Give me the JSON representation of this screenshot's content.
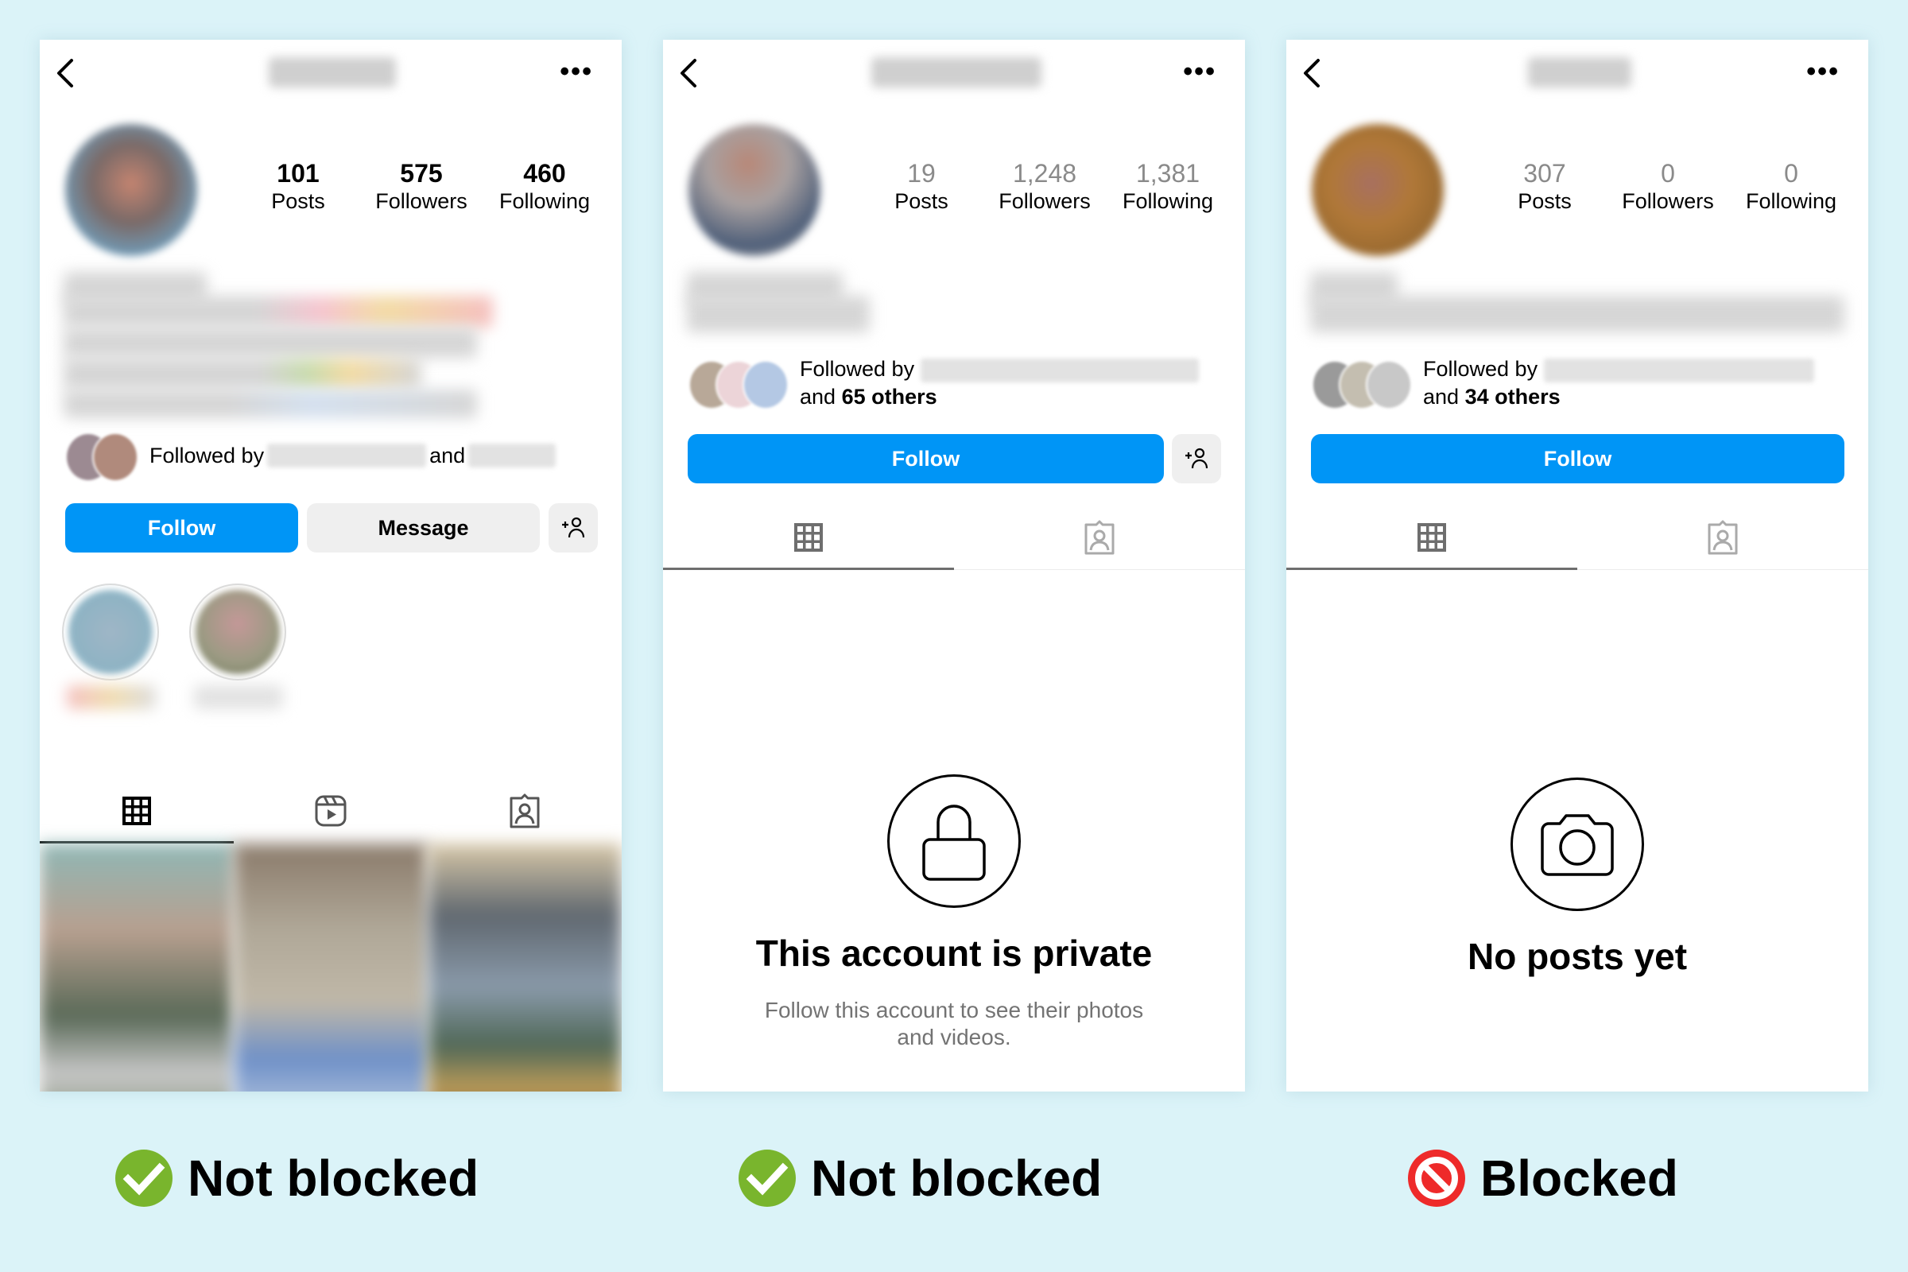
{
  "colors": {
    "background": "#dbf3f8",
    "follow_button": "#0095f6",
    "secondary_button": "#efefef",
    "check_green": "#79b52d",
    "blocked_red": "#ee2a2a"
  },
  "panels": [
    {
      "stats": [
        {
          "value": "101",
          "label": "Posts"
        },
        {
          "value": "575",
          "label": "Followers"
        },
        {
          "value": "460",
          "label": "Following"
        }
      ],
      "followed_by": {
        "prefix": "Followed by",
        "joiner": "and"
      },
      "buttons": {
        "follow": "Follow",
        "message": "Message"
      },
      "tabs": [
        "grid-icon",
        "reels-icon",
        "tagged-icon"
      ],
      "verdict": {
        "icon": "check-circle-icon",
        "label": "Not blocked"
      }
    },
    {
      "stats": [
        {
          "value": "19",
          "label": "Posts"
        },
        {
          "value": "1,248",
          "label": "Followers"
        },
        {
          "value": "1,381",
          "label": "Following"
        }
      ],
      "followed_by": {
        "prefix": "Followed by",
        "line2_prefix": "and",
        "count": "65 others"
      },
      "buttons": {
        "follow": "Follow"
      },
      "tabs": [
        "grid-icon",
        "tagged-icon"
      ],
      "empty_state": {
        "icon": "lock-icon",
        "title": "This account is private",
        "subtitle_line1": "Follow this account to see their photos",
        "subtitle_line2": "and videos."
      },
      "verdict": {
        "icon": "check-circle-icon",
        "label": "Not blocked"
      }
    },
    {
      "stats": [
        {
          "value": "307",
          "label": "Posts"
        },
        {
          "value": "0",
          "label": "Followers"
        },
        {
          "value": "0",
          "label": "Following"
        }
      ],
      "followed_by": {
        "prefix": "Followed by",
        "line2_prefix": "and",
        "count": "34 others"
      },
      "buttons": {
        "follow": "Follow"
      },
      "tabs": [
        "grid-icon",
        "tagged-icon"
      ],
      "empty_state": {
        "icon": "camera-icon",
        "title": "No posts yet"
      },
      "verdict": {
        "icon": "prohibited-icon",
        "label": "Blocked"
      }
    }
  ]
}
